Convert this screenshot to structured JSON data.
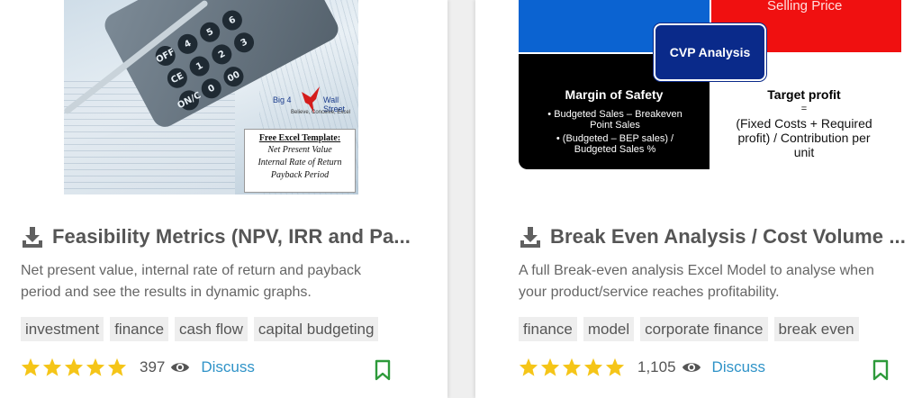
{
  "colors": {
    "star": "#f5c518",
    "link": "#2f93c8",
    "bookmark": "#2d9a3a",
    "title": "#555555"
  },
  "cards": [
    {
      "thumbnail": {
        "calc_keys": [
          "OFF",
          "4",
          "5",
          "6",
          "CE",
          "1",
          "2",
          "3",
          "ON/C",
          "0",
          "00"
        ],
        "logo_left": "Big 4",
        "logo_right": "Wall Street",
        "logo_tagline": "Believe, Conceive, Excel",
        "template_title": "Free Excel Template:",
        "template_lines": [
          "Net Present Value",
          "Internal Rate of Return",
          "Payback Period"
        ]
      },
      "download_icon": "download-icon",
      "title": "Feasibility Metrics (NPV, IRR and Pa...",
      "description_line1": "Net present value, internal rate of return and payback",
      "description_line2": "period and see the results in dynamic graphs.",
      "tags": [
        "investment",
        "finance",
        "cash flow",
        "capital budgeting"
      ],
      "rating": 5,
      "views": "397",
      "discuss": "Discuss"
    },
    {
      "thumbnail": {
        "selling": "Selling Price",
        "center": "CVP Analysis",
        "mos_title": "Margin of Safety",
        "mos_line1": "• Budgeted Sales – Breakeven",
        "mos_line2": "Point Sales",
        "mos_line3": "• (Budgeted – BEP sales) /",
        "mos_line4": "Budgeted Sales %",
        "tp_title": "Target profit",
        "tp_eq": "=",
        "tp_line1": "(Fixed Costs + Required",
        "tp_line2": "profit) / Contribution per",
        "tp_line3": "unit"
      },
      "download_icon": "download-icon",
      "title": "Break Even Analysis / Cost Volume ...",
      "description_line1": "A full Break-even analysis Excel Model to analyse when",
      "description_line2": "your product/service reaches profitability.",
      "tags": [
        "finance",
        "model",
        "corporate finance",
        "break even"
      ],
      "rating": 5,
      "views": "1,105",
      "discuss": "Discuss"
    }
  ]
}
